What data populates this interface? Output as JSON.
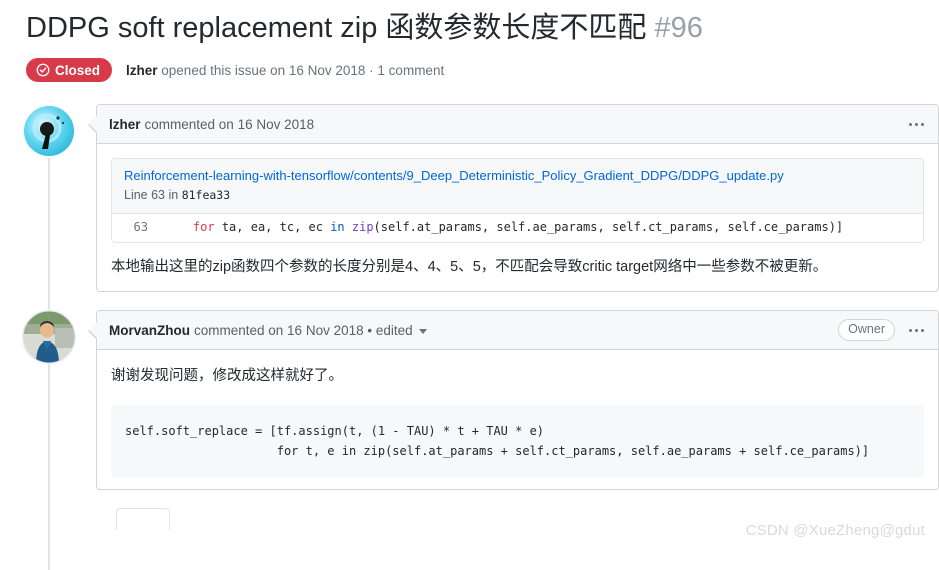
{
  "issue": {
    "title": "DDPG soft replacement zip 函数参数长度不匹配",
    "number": "#96",
    "state_label": "Closed",
    "state_color": "#d73a49",
    "meta_author": "lzher",
    "meta_text": " opened this issue on 16 Nov 2018 · 1 comment"
  },
  "comments": [
    {
      "author": "lzher",
      "meta": " commented on 16 Nov 2018",
      "code_ref": {
        "path": "Reinforcement-learning-with-tensorflow/contents/9_Deep_Deterministic_Policy_Gradient_DDPG/DDPG_update.py",
        "line_prefix": "Line 63 in ",
        "sha": "81fea33",
        "line_number": "63",
        "code_indent": "    ",
        "code_kw": "for",
        "code_mid": " ta, ea, tc, ec ",
        "code_in": "in",
        "code_fn": " zip",
        "code_tail": "(self.at_params, self.ae_params, self.ct_params, self.ce_params)]"
      },
      "body_text": "本地输出这里的zip函数四个参数的长度分别是4、4、5、5，不匹配会导致critic target网络中一些参数不被更新。"
    },
    {
      "author": "MorvanZhou",
      "meta": " commented on 16 Nov 2018 • edited",
      "badge": "Owner",
      "body_text": "谢谢发现问题，修改成这样就好了。",
      "code_block": "self.soft_replace = [tf.assign(t, (1 - TAU) * t + TAU * e)\n                     for t, e in zip(self.at_params + self.ct_params, self.ae_params + self.ce_params)]"
    }
  ],
  "watermark": "CSDN @XueZheng@gdut"
}
